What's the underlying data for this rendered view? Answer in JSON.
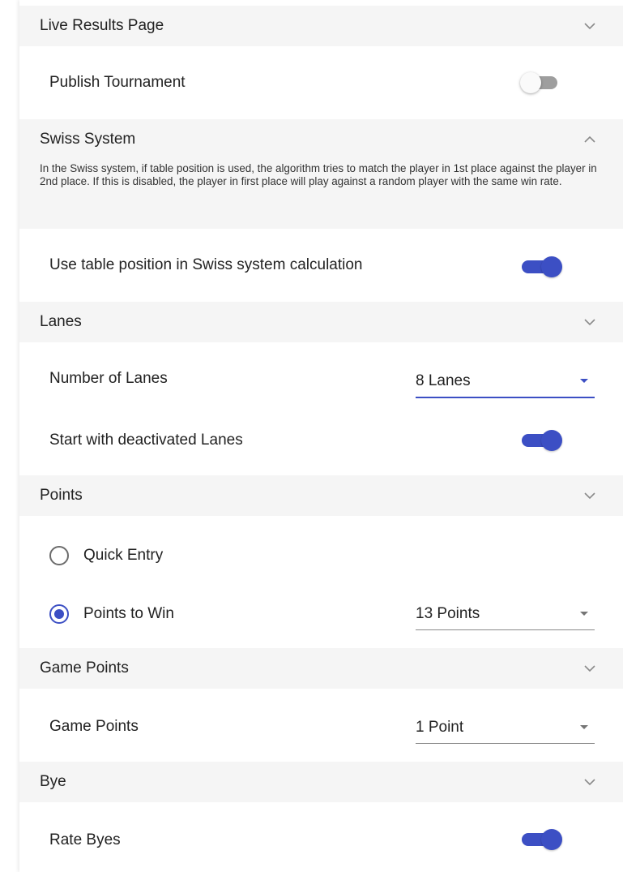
{
  "sections": {
    "live_results": {
      "title": "Live Results Page",
      "publish_label": "Publish Tournament",
      "publish_enabled": false
    },
    "swiss": {
      "title": "Swiss System",
      "description": "In the Swiss system, if table position is used, the algorithm tries to match the player in 1st place against the player in 2nd place. If this is disabled, the player in first place will play against a random player with the same win rate.",
      "use_table_position_label": "Use table position in Swiss system calculation",
      "use_table_position_enabled": true
    },
    "lanes": {
      "title": "Lanes",
      "number_label": "Number of Lanes",
      "number_value": "8 Lanes",
      "deactivated_label": "Start with deactivated Lanes",
      "deactivated_enabled": true
    },
    "points": {
      "title": "Points",
      "quick_entry_label": "Quick Entry",
      "quick_entry_selected": false,
      "points_to_win_label": "Points to Win",
      "points_to_win_selected": true,
      "points_to_win_value": "13 Points"
    },
    "game_points": {
      "title": "Game Points",
      "label": "Game Points",
      "value": "1 Point"
    },
    "bye": {
      "title": "Bye",
      "rate_label": "Rate Byes",
      "rate_enabled": true
    }
  },
  "colors": {
    "accent": "#3c4fc4",
    "header_bg": "#f5f5f5",
    "toggle_off": "#9e9e9e"
  },
  "icons": {
    "expand": "chevron-down-icon",
    "collapse": "chevron-up-icon"
  }
}
